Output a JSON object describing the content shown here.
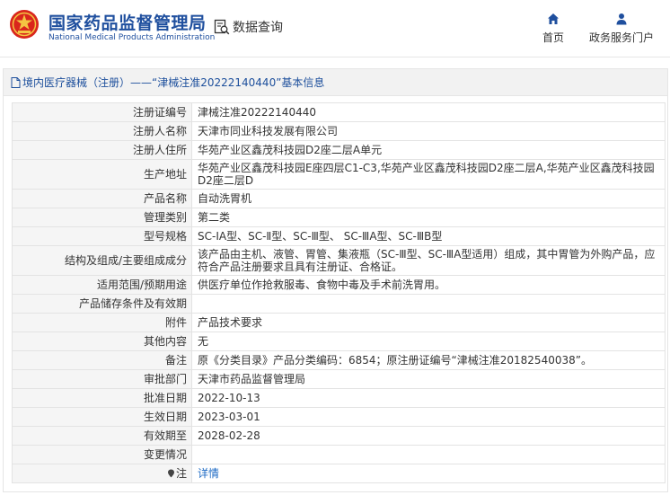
{
  "header": {
    "brand_cn": "国家药品监督管理局",
    "brand_en": "National Medical Products Administration",
    "search_label": "数据查询",
    "nav": {
      "home_label": "首页",
      "service_label": "政务服务门户"
    }
  },
  "panel": {
    "title": "境内医疗器械（注册）——“津械注准20222140440”基本信息"
  },
  "rows": [
    {
      "label": "注册证编号",
      "value": "津械注准20222140440"
    },
    {
      "label": "注册人名称",
      "value": "天津市同业科技发展有限公司"
    },
    {
      "label": "注册人住所",
      "value": "华苑产业区鑫茂科技园D2座二层A单元"
    },
    {
      "label": "生产地址",
      "value": "华苑产业区鑫茂科技园E座四层C1-C3,华苑产业区鑫茂科技园D2座二层A,华苑产业区鑫茂科技园D2座二层D"
    },
    {
      "label": "产品名称",
      "value": "自动洗胃机"
    },
    {
      "label": "管理类别",
      "value": "第二类"
    },
    {
      "label": "型号规格",
      "value": "SC-ⅠA型、SC-Ⅱ型、SC-Ⅲ型、 SC-ⅢA型、SC-ⅢB型"
    },
    {
      "label": "结构及组成/主要组成成分",
      "value": "该产品由主机、液管、胃管、集液瓶（SC-Ⅲ型、SC-ⅢA型适用）组成，其中胃管为外购产品，应符合产品注册要求且具有注册证、合格证。"
    },
    {
      "label": "适用范围/预期用途",
      "value": "供医疗单位作抢救服毒、食物中毒及手术前洗胃用。"
    },
    {
      "label": "产品储存条件及有效期",
      "value": ""
    },
    {
      "label": "附件",
      "value": "产品技术要求"
    },
    {
      "label": "其他内容",
      "value": "无"
    },
    {
      "label": "备注",
      "value": "原《分类目录》产品分类编码：6854；原注册证编号“津械注准20182540038”。"
    },
    {
      "label": "审批部门",
      "value": "天津市药品监督管理局"
    },
    {
      "label": "批准日期",
      "value": "2022-10-13"
    },
    {
      "label": "生效日期",
      "value": "2023-03-01"
    },
    {
      "label": "有效期至",
      "value": "2028-02-28"
    },
    {
      "label": "变更情况",
      "value": ""
    }
  ],
  "note_row": {
    "label": "注",
    "link": "详情"
  }
}
